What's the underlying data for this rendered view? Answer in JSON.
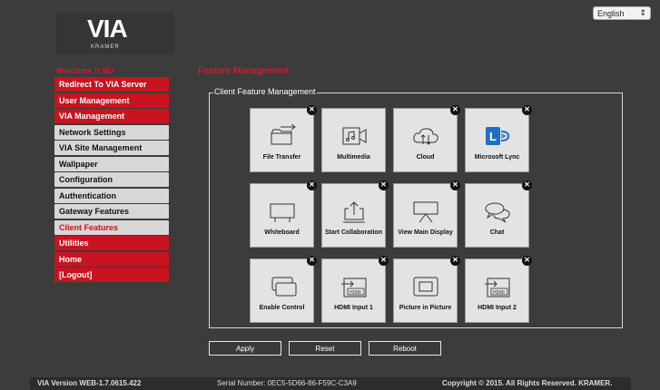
{
  "logo": {
    "text": "VIA",
    "subtext": "KRAMER"
  },
  "language": {
    "selected": "English",
    "arrow": "⇕"
  },
  "welcome": "Welcome !! SU",
  "menu": [
    {
      "label": "Redirect To VIA Server",
      "style": "red"
    },
    {
      "label": "User Management",
      "style": "red"
    },
    {
      "label": "VIA Management",
      "style": "red"
    },
    {
      "label": "Network Settings",
      "style": "gray"
    },
    {
      "label": "VIA Site Management",
      "style": "gray"
    },
    {
      "label": "Wallpaper",
      "style": "gray"
    },
    {
      "label": "Configuration",
      "style": "gray"
    },
    {
      "label": "Authentication",
      "style": "gray"
    },
    {
      "label": "Gateway Features",
      "style": "gray"
    },
    {
      "label": "Client Features",
      "style": "sel"
    },
    {
      "label": "Utilities",
      "style": "red"
    },
    {
      "label": "Home",
      "style": "red"
    },
    {
      "label": "[Logout]",
      "style": "red"
    }
  ],
  "page_title": "Feature Management",
  "fieldset_legend": "Client Feature Management",
  "features": [
    {
      "label": "File Transfer",
      "icon": "file-transfer-icon"
    },
    {
      "label": "Multimedia",
      "icon": "multimedia-icon"
    },
    {
      "label": "Cloud",
      "icon": "cloud-icon"
    },
    {
      "label": "Microsoft Lync",
      "icon": "lync-icon"
    },
    {
      "label": "Whiteboard",
      "icon": "whiteboard-icon"
    },
    {
      "label": "Start Collaboration",
      "icon": "collaboration-icon"
    },
    {
      "label": "View Main Display",
      "icon": "display-icon"
    },
    {
      "label": "Chat",
      "icon": "chat-icon"
    },
    {
      "label": "Enable Control",
      "icon": "control-icon"
    },
    {
      "label": "HDMI Input 1",
      "icon": "hdmi-icon"
    },
    {
      "label": "Picture in Picture",
      "icon": "pip-icon"
    },
    {
      "label": "HDMI Input 2",
      "icon": "hdmi-icon"
    }
  ],
  "close_glyph": "✕",
  "hdmi_text": "HDMI",
  "lync_letter": "L",
  "buttons": {
    "apply": "Apply",
    "reset": "Reset",
    "reboot": "Reboot"
  },
  "footer": {
    "version": "VIA Version WEB-1.7.0615.422",
    "serial": "Serial Number: 0EC5-5D66-86-F59C-C3A9",
    "copyright": "Copyright © 2015. All Rights Reserved. KRAMER."
  },
  "colors": {
    "accent_red": "#c8141f",
    "background": "#3c3c3c",
    "lync_blue": "#1f6fc6"
  }
}
